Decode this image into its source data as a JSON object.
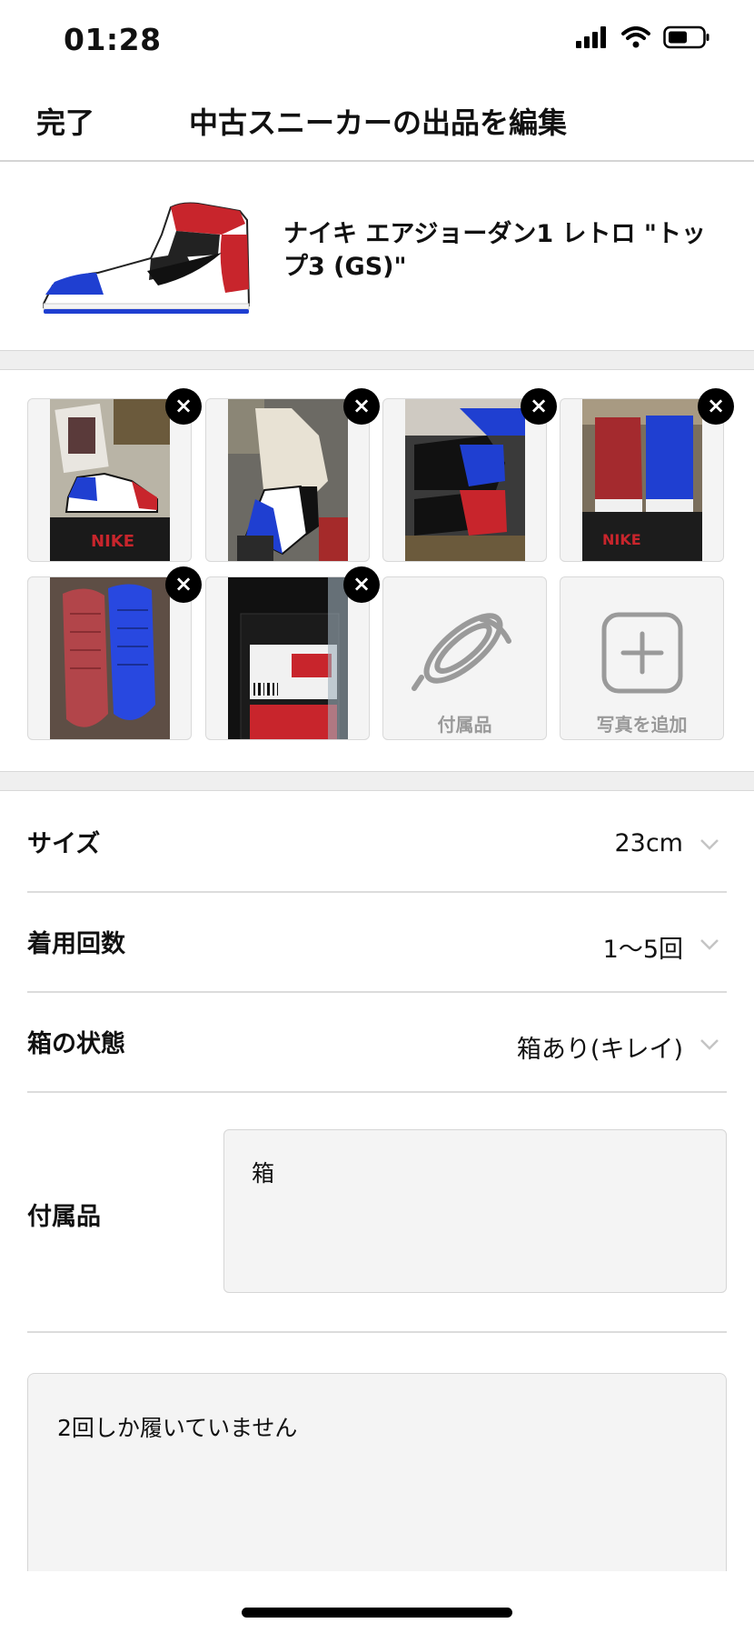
{
  "status": {
    "time": "01:28"
  },
  "nav": {
    "done": "完了",
    "title": "中古スニーカーの出品を編集"
  },
  "product": {
    "name": "ナイキ エアジョーダン1 レトロ \"トップ3 (GS)\""
  },
  "photos": {
    "remove_glyph": "×",
    "accessories_label": "付属品",
    "add_photo_label": "写真を追加"
  },
  "fields": {
    "size": {
      "label": "サイズ",
      "value": "23cm"
    },
    "wear_count": {
      "label": "着用回数",
      "value": "1〜5回"
    },
    "box_condition": {
      "label": "箱の状態",
      "value": "箱あり(キレイ)"
    },
    "accessories": {
      "label": "付属品",
      "value": "箱"
    }
  },
  "description": {
    "value": "2回しか履いていません"
  },
  "colors": {
    "brand_red": "#c8252c",
    "brand_blue": "#1f3fd1",
    "icon_gray": "#9a9a9a"
  }
}
